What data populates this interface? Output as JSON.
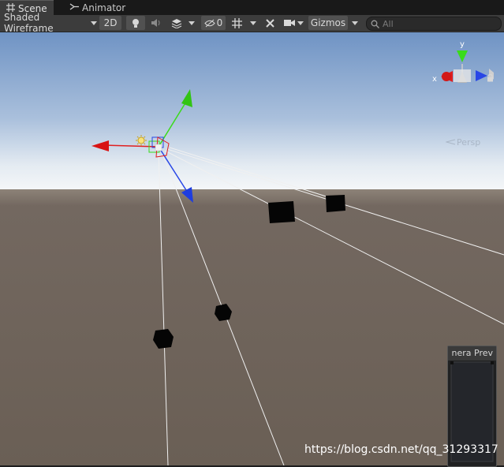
{
  "tabs": [
    {
      "label": "Scene",
      "icon": "grid-icon",
      "active": true
    },
    {
      "label": "Animator",
      "icon": "animator-icon",
      "active": false
    }
  ],
  "toolbar": {
    "draw_mode": "Shaded Wireframe",
    "mode_2d": "2D",
    "hidden_count": "0",
    "gizmos": "Gizmos",
    "search_placeholder": "All"
  },
  "scene_gizmo": {
    "projection": "Persp",
    "axis_x": "x",
    "axis_y": "y",
    "axis_colors": {
      "x": "#e02020",
      "y": "#3adb1a",
      "z": "#2846e6"
    }
  },
  "camera_preview": {
    "title": "nera Prev"
  },
  "watermark": "https://blog.csdn.net/qq_31293317",
  "colors": {
    "sky_top": "#6f93c4",
    "horizon": "#f4f6f8",
    "ground": "#6c6156",
    "toolbar_bg": "#3c3c3c"
  }
}
